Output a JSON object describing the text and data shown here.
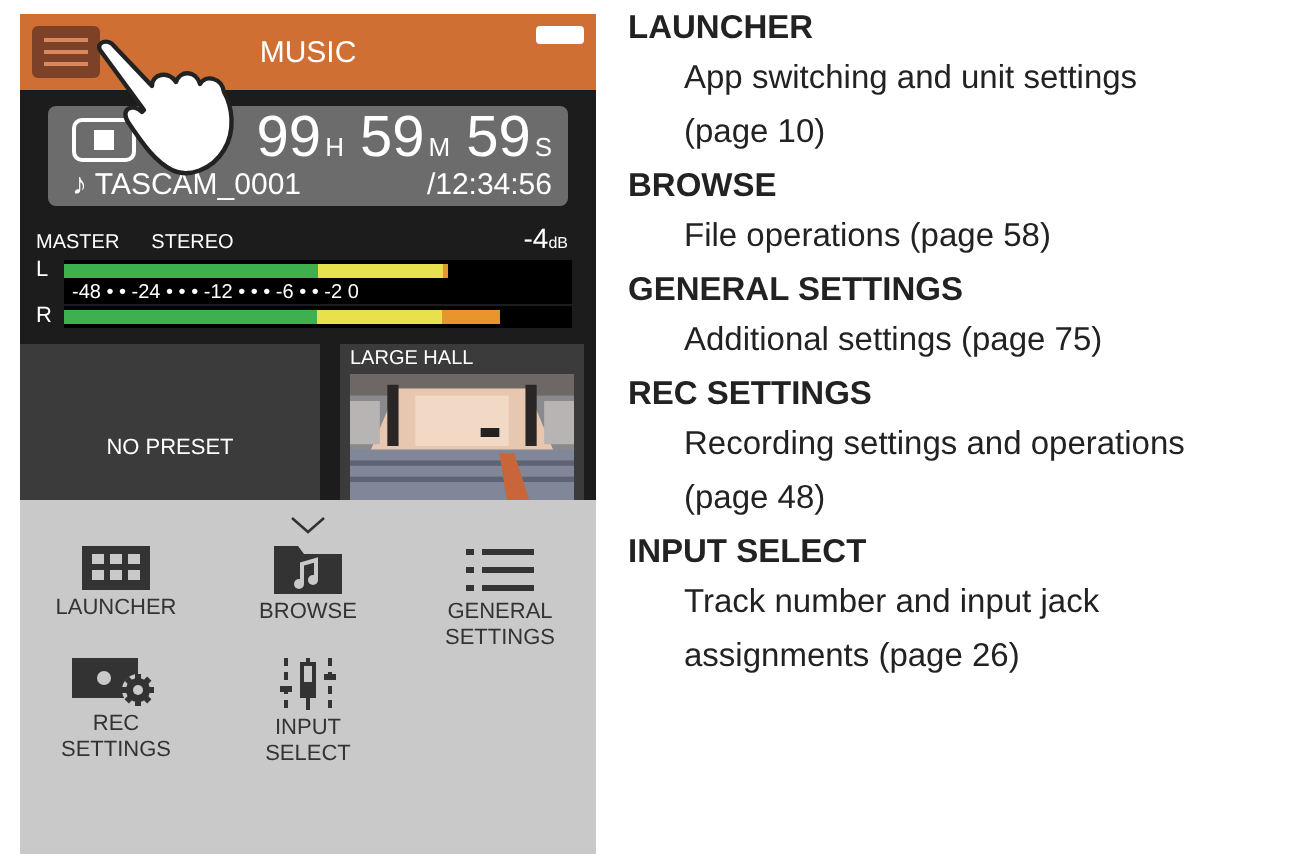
{
  "device": {
    "header": {
      "title": "MUSIC"
    },
    "counter": {
      "hours": "99",
      "hours_unit": "H",
      "minutes": "59",
      "minutes_unit": "M",
      "seconds": "59",
      "seconds_unit": "S",
      "file": "♪ TASCAM_0001",
      "total": "/12:34:56"
    },
    "meter": {
      "bus": "MASTER",
      "mode": "STEREO",
      "gain": "-4",
      "gain_unit": "dB",
      "scale": "-48 • • -24 • • • -12 • • • -6 • • -2 0",
      "channels": [
        {
          "name": "L",
          "level": 0.755
        },
        {
          "name": "R",
          "level": 0.86
        }
      ]
    },
    "presets": [
      {
        "kind": "empty",
        "label": "NO PRESET"
      },
      {
        "kind": "picture",
        "label": "LARGE HALL"
      }
    ],
    "menu": [
      {
        "label": "LAUNCHER"
      },
      {
        "label": "BROWSE"
      },
      {
        "label": "GENERAL SETTINGS"
      },
      {
        "label": "REC SETTINGS"
      },
      {
        "label": "INPUT SELECT"
      }
    ]
  },
  "legend": [
    {
      "term": "LAUNCHER",
      "description": "App switching and unit settings (page 10)"
    },
    {
      "term": "BROWSE",
      "description": "File operations (page 58)"
    },
    {
      "term": "GENERAL SETTINGS",
      "description": "Additional settings (page 75)"
    },
    {
      "term": "REC SETTINGS",
      "description": "Recording settings and operations (page 48)"
    },
    {
      "term": "INPUT SELECT",
      "description": "Track number and input jack assignments (page 26)"
    }
  ]
}
